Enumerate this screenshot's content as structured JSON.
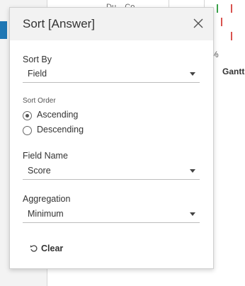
{
  "background": {
    "top_text": "Du...  Co...",
    "percent": "%",
    "gantt_label": "Gantt"
  },
  "dialog": {
    "title": "Sort [Answer]",
    "sort_by": {
      "label": "Sort By",
      "value": "Field"
    },
    "sort_order": {
      "label": "Sort Order",
      "options": [
        {
          "label": "Ascending",
          "selected": true
        },
        {
          "label": "Descending",
          "selected": false
        }
      ]
    },
    "field_name": {
      "label": "Field Name",
      "value": "Score"
    },
    "aggregation": {
      "label": "Aggregation",
      "value": "Minimum"
    },
    "clear_label": "Clear"
  },
  "icons": [
    "close-icon",
    "reset-icon",
    "chevron-down-icon",
    "radio-icon"
  ],
  "colors": {
    "header_bg": "#f2f2f2",
    "accent": "#1f77b4"
  }
}
